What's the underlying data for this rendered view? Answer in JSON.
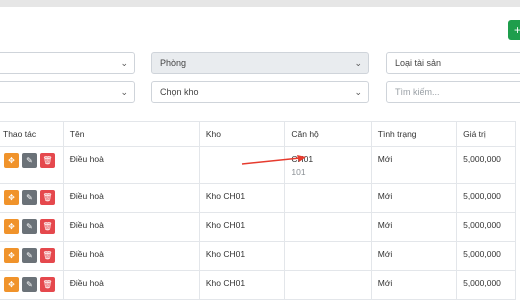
{
  "header": {
    "add_icon": "+"
  },
  "filters": {
    "row1": {
      "select_left": "",
      "room": "Phòng",
      "asset_type": "Loại tài sản"
    },
    "row2": {
      "select_left": "",
      "warehouse": "Chọn kho",
      "search_placeholder": "Tìm kiếm..."
    }
  },
  "table": {
    "columns": [
      "Thao tác",
      "Tên",
      "Kho",
      "Căn hộ",
      "Tình trạng",
      "Giá trị"
    ],
    "rows": [
      {
        "name": "Điều hoà",
        "warehouse": "",
        "apartment": "CH01",
        "apartment_sub": "101",
        "status": "Mới",
        "value": "5,000,000"
      },
      {
        "name": "Điều hoà",
        "warehouse": "Kho CH01",
        "apartment": "",
        "apartment_sub": "",
        "status": "Mới",
        "value": "5,000,000"
      },
      {
        "name": "Điều hoà",
        "warehouse": "Kho CH01",
        "apartment": "",
        "apartment_sub": "",
        "status": "Mới",
        "value": "5,000,000"
      },
      {
        "name": "Điều hoà",
        "warehouse": "Kho CH01",
        "apartment": "",
        "apartment_sub": "",
        "status": "Mới",
        "value": "5,000,000"
      },
      {
        "name": "Điều hoà",
        "warehouse": "Kho CH01",
        "apartment": "",
        "apartment_sub": "",
        "status": "Mới",
        "value": "5,000,000"
      }
    ]
  },
  "icons": {
    "move": "move-icon",
    "edit": "edit-icon",
    "delete": "trash-icon"
  },
  "colors": {
    "move": "#f0932b",
    "edit": "#6b7278",
    "delete": "#e5484d",
    "add": "#1e9e4c",
    "annotation_arrow": "#e63b2e"
  }
}
